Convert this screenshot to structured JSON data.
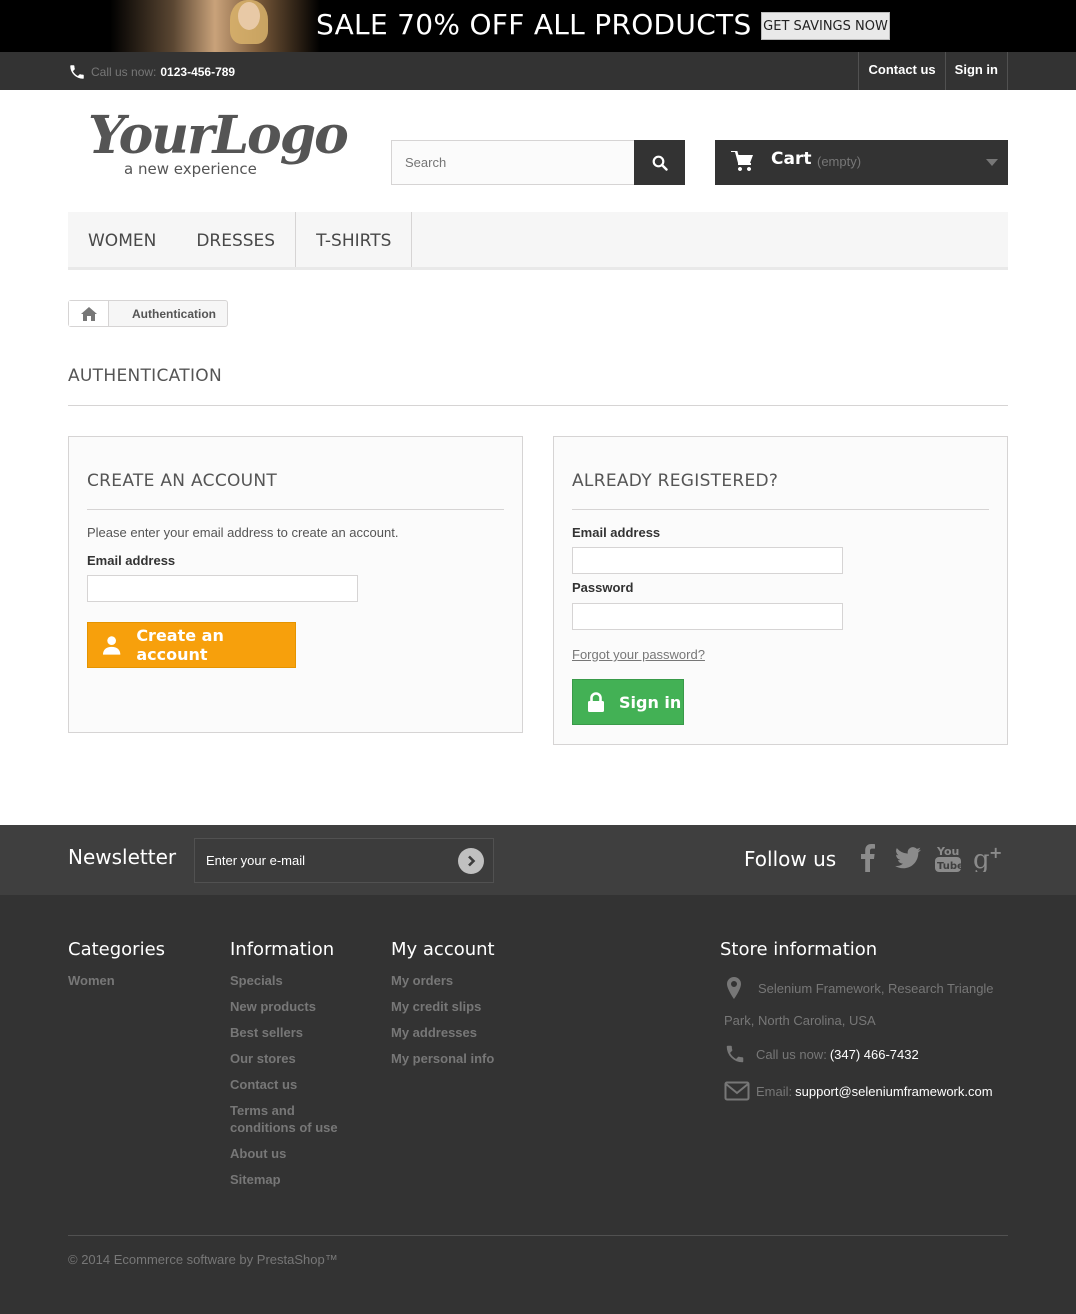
{
  "banner": {
    "sale_text": "SALE 70% OFF ALL PRODUCTS",
    "cta": "GET SAVINGS NOW"
  },
  "nav": {
    "call_label": "Call us now:",
    "phone": "0123-456-789",
    "contact": "Contact us",
    "signin": "Sign in"
  },
  "logo": {
    "main": "YourLogo",
    "tagline": "a new experience"
  },
  "search": {
    "placeholder": "Search"
  },
  "cart": {
    "label": "Cart",
    "status": "(empty)"
  },
  "menu": {
    "items": [
      "WOMEN",
      "DRESSES",
      "T-SHIRTS"
    ]
  },
  "breadcrumb": {
    "current": "Authentication"
  },
  "page": {
    "heading": "AUTHENTICATION"
  },
  "create_account": {
    "title": "CREATE AN ACCOUNT",
    "description": "Please enter your email address to create an account.",
    "email_label": "Email address",
    "email_value": "",
    "button": "Create an account"
  },
  "login": {
    "title": "ALREADY REGISTERED?",
    "email_label": "Email address",
    "email_value": "",
    "password_label": "Password",
    "password_value": "",
    "forgot": "Forgot your password?",
    "button": "Sign in"
  },
  "newsletter": {
    "title": "Newsletter",
    "placeholder": "Enter your e-mail"
  },
  "follow": {
    "title": "Follow us",
    "networks": [
      "facebook-icon",
      "twitter-icon",
      "youtube-icon",
      "google-plus-icon"
    ]
  },
  "footer": {
    "categories": {
      "title": "Categories",
      "items": [
        "Women"
      ]
    },
    "information": {
      "title": "Information",
      "items": [
        "Specials",
        "New products",
        "Best sellers",
        "Our stores",
        "Contact us",
        "Terms and conditions of use",
        "About us",
        "Sitemap"
      ]
    },
    "account": {
      "title": "My account",
      "items": [
        "My orders",
        "My credit slips",
        "My addresses",
        "My personal info"
      ]
    },
    "store": {
      "title": "Store information",
      "address_line1": "Selenium Framework, Research Triangle",
      "address_line2": "Park, North Carolina, USA",
      "call_label": "Call us now:",
      "phone": "(347) 466-7432",
      "email_label": "Email:",
      "email": "support@seleniumframework.com"
    },
    "copyright": "© 2014 Ecommerce software by PrestaShop™"
  },
  "colors": {
    "orange": "#f7a00c",
    "green": "#43b155",
    "dark": "#333333"
  }
}
